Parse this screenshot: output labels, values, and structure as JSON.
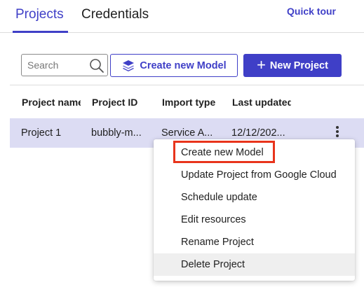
{
  "tabs": [
    {
      "label": "Projects",
      "active": true
    },
    {
      "label": "Credentials",
      "active": false
    }
  ],
  "quick_tour": "Quick tour",
  "toolbar": {
    "search_placeholder": "Search",
    "create_model_label": "Create new Model",
    "new_project_label": "New Project"
  },
  "table": {
    "columns": [
      "Project name",
      "Project ID",
      "Import type",
      "Last updated"
    ],
    "rows": [
      {
        "name": "Project 1",
        "id": "bubbly-m...",
        "import_type": "Service A...",
        "last_updated": "12/12/202..."
      }
    ]
  },
  "menu": {
    "items": [
      "Create new Model",
      "Update Project from Google Cloud",
      "Schedule update",
      "Edit resources",
      "Rename Project",
      "Delete Project"
    ]
  },
  "colors": {
    "accent": "#3f3fc7",
    "row_selected": "#dcdcf3",
    "highlight": "#e8341c"
  }
}
